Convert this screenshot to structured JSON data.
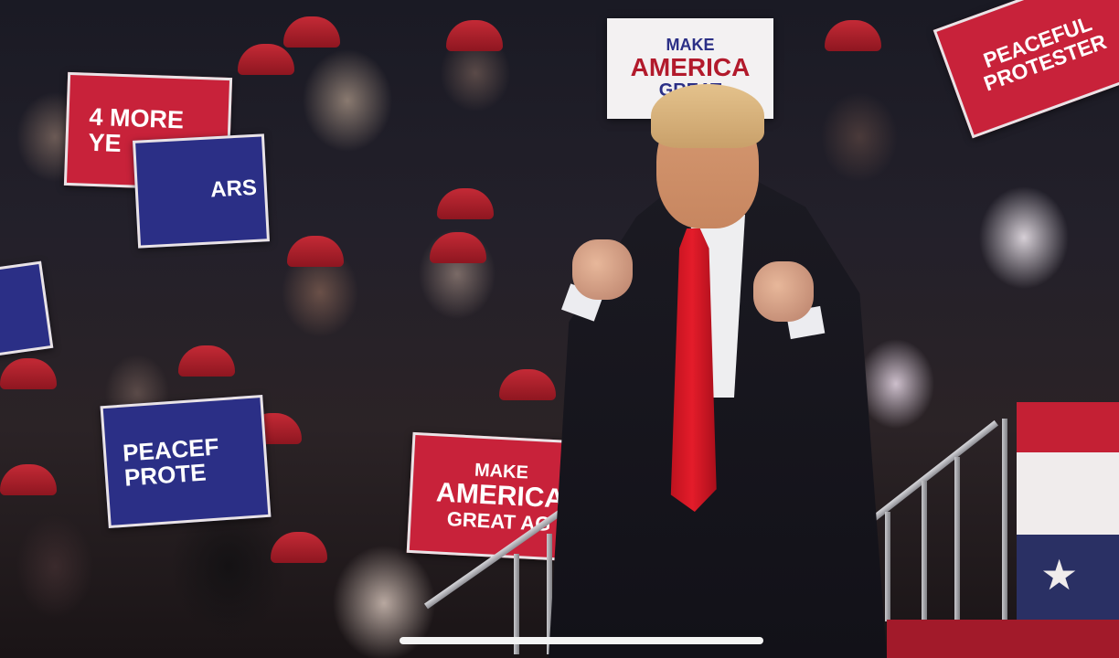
{
  "photo": {
    "subject_colors": {
      "tie": "#e41c2a",
      "suit": "#16151c",
      "sign_red": "#c8223a",
      "sign_blue": "#2b2f86"
    }
  },
  "signs": [
    {
      "id": "four-more-years",
      "lines": [
        "4 MORE",
        "YE"
      ]
    },
    {
      "id": "four-more-years-blue",
      "lines": [
        "",
        "ARS"
      ]
    },
    {
      "id": "peaceful-protester-top-right",
      "lines": [
        "PEACEFUL",
        "PROTESTER"
      ]
    },
    {
      "id": "make-america-great-top",
      "lines": [
        "MAKE",
        "AMERICA",
        "GREAT"
      ]
    },
    {
      "id": "make-america-great-bottom",
      "lines": [
        "MAKE",
        "AMERICA",
        "GREAT AG"
      ]
    },
    {
      "id": "peaceful-protester-left",
      "lines": [
        "PEACEF",
        "PROTE"
      ]
    }
  ],
  "flag_star": "★"
}
